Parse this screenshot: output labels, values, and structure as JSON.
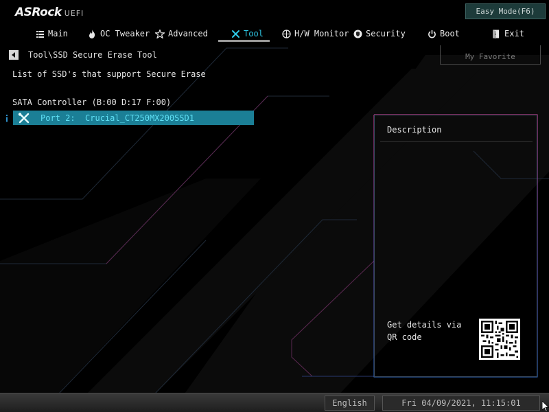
{
  "header": {
    "brand": "ASRock",
    "sub": "UEFI",
    "easy_mode": "Easy Mode(F6)"
  },
  "nav": {
    "tabs": [
      {
        "label": "Main",
        "icon": "list-icon"
      },
      {
        "label": "OC Tweaker",
        "icon": "flame-icon"
      },
      {
        "label": "Advanced",
        "icon": "star-icon"
      },
      {
        "label": "Tool",
        "icon": "tools-icon",
        "active": true
      },
      {
        "label": "H/W Monitor",
        "icon": "monitor-icon"
      },
      {
        "label": "Security",
        "icon": "shield-icon"
      },
      {
        "label": "Boot",
        "icon": "power-icon"
      },
      {
        "label": "Exit",
        "icon": "exit-icon"
      }
    ]
  },
  "favorite": "My Favorite",
  "breadcrumb": "Tool\\SSD Secure Erase Tool",
  "content": {
    "list_title": "List of SSD's that support Secure Erase",
    "controller": "SATA Controller (B:00 D:17 F:00)",
    "item": "Port 2:  Crucial_CT250MX200SSD1"
  },
  "description": {
    "title": "Description",
    "qr_text": "Get details via QR code"
  },
  "footer": {
    "language": "English",
    "datetime": "Fri 04/09/2021, 11:15:01"
  },
  "colors": {
    "accent": "#2ec8e6",
    "selection": "#1b7f96"
  }
}
